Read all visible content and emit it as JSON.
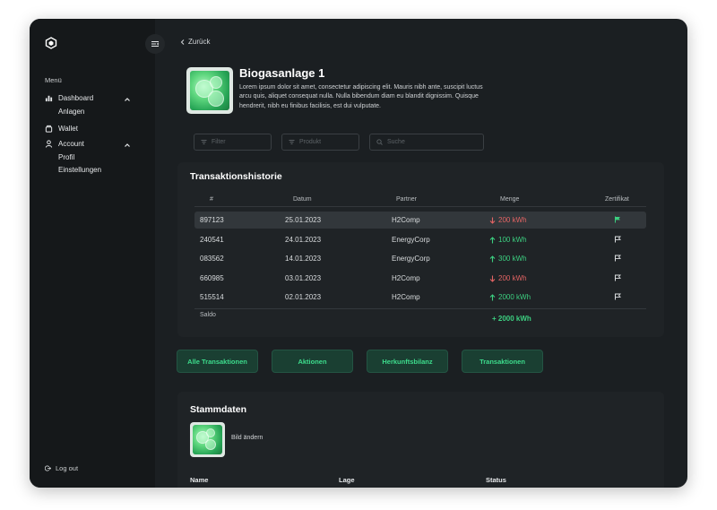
{
  "sidebar": {
    "menu_label": "Menü",
    "items": [
      {
        "label": "Dashboard",
        "icon": "bar-chart-icon",
        "children": [
          "Anlagen"
        ]
      },
      {
        "label": "Wallet",
        "icon": "wallet-icon"
      },
      {
        "label": "Account",
        "icon": "user-icon",
        "children": [
          "Profil",
          "Einstellungen"
        ]
      }
    ],
    "logout_label": "Log out"
  },
  "header": {
    "back_label": "Zurück"
  },
  "plant": {
    "title": "Biogasanlage 1",
    "description": "Lorem ipsum dolor sit amet, consectetur adipiscing elit. Mauris nibh ante, suscipit luctus arcu quis, aliquet consequat nulla. Nulla bibendum diam eu blandit dignissim. Quisque hendrerit, nibh eu finibus facilisis, est dui vulputate."
  },
  "filters": {
    "filter_placeholder": "Filter",
    "product_placeholder": "Produkt",
    "search_placeholder": "Suche"
  },
  "transactions": {
    "title": "Transaktionshistorie",
    "columns": [
      "#",
      "Datum",
      "Partner",
      "Menge",
      "Zertifikat"
    ],
    "rows": [
      {
        "id": "897123",
        "date": "25.01.2023",
        "partner": "H2Comp",
        "amount": "200 kWh",
        "direction": "out",
        "certified": true
      },
      {
        "id": "240541",
        "date": "24.01.2023",
        "partner": "EnergyCorp",
        "amount": "100 kWh",
        "direction": "in",
        "certified": false
      },
      {
        "id": "083562",
        "date": "14.01.2023",
        "partner": "EnergyCorp",
        "amount": "300 kWh",
        "direction": "in",
        "certified": false
      },
      {
        "id": "660985",
        "date": "03.01.2023",
        "partner": "H2Comp",
        "amount": "200 kWh",
        "direction": "out",
        "certified": false
      },
      {
        "id": "515514",
        "date": "02.01.2023",
        "partner": "H2Comp",
        "amount": "2000 kWh",
        "direction": "in",
        "certified": false
      }
    ],
    "saldo_label": "Saldo",
    "saldo_value": "+ 2000 kWh"
  },
  "actions": [
    "Alle Transaktionen",
    "Aktionen",
    "Herkunftsbilanz",
    "Transaktionen"
  ],
  "master_data": {
    "title": "Stammdaten",
    "change_image_label": "Bild ändern",
    "columns": [
      "Name",
      "Lage",
      "Status"
    ]
  },
  "colors": {
    "accent_green": "#3ccf80",
    "negative_red": "#e36464",
    "background": "#1b1f22",
    "sidebar": "#15181a"
  }
}
